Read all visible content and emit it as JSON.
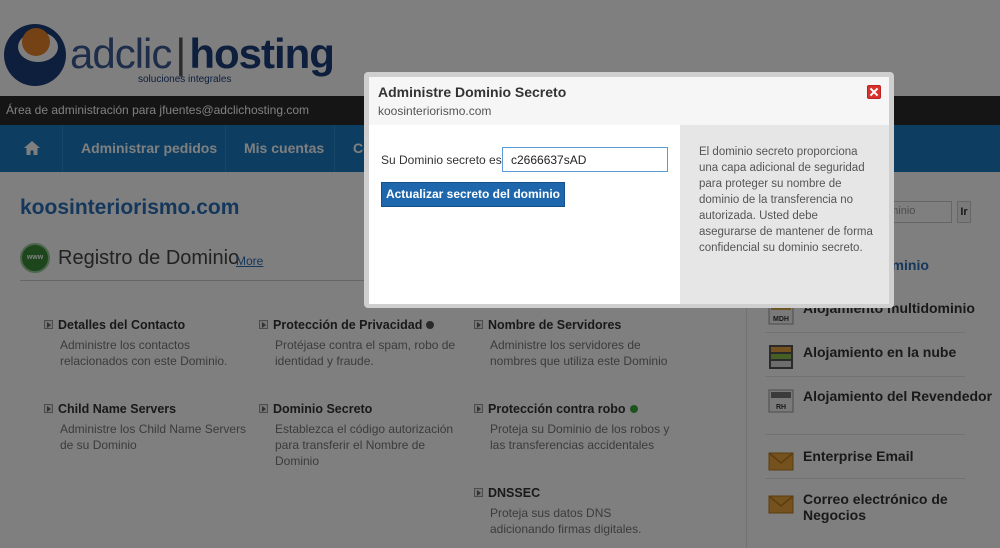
{
  "brand": {
    "name_light": "adclic",
    "name_separator": "|",
    "name_bold": "hosting",
    "tagline": "soluciones integrales",
    "colors": {
      "navy": "#1d3d7a",
      "orange": "#e8842a",
      "nav_blue": "#1a7dc2",
      "link_blue": "#2a6fb8"
    }
  },
  "admin_bar": {
    "text": "Área de administración para jfuentes@adclichosting.com"
  },
  "nav": {
    "home_icon": "home-icon",
    "items": [
      {
        "label": "Administrar pedidos"
      },
      {
        "label": "Mis cuentas"
      },
      {
        "label": "Co"
      }
    ]
  },
  "main": {
    "domain": "koosinteriorismo.com",
    "section": {
      "icon": "www-globe-icon",
      "icon_text": "www",
      "title": "Registro de Dominio",
      "more_link": "More"
    },
    "features": [
      {
        "title": "Detalles del Contacto",
        "desc": "Administre los contactos relacionados con este Dominio."
      },
      {
        "title": "Protección de Privacidad",
        "status_dot": "#555555",
        "desc": "Protéjase contra el spam, robo de identidad y fraude."
      },
      {
        "title": "Nombre de Servidores",
        "desc": "Administre los servidores de nombres que utiliza este Dominio"
      },
      {
        "title": "Child Name Servers",
        "desc": "Administre los Child Name Servers de su Dominio"
      },
      {
        "title": "Dominio Secreto",
        "desc": "Establezca el código autorización para transferir el Nombre de Dominio"
      },
      {
        "title": "Protección contra robo",
        "status_dot": "#3aa83a",
        "desc": "Proteja su Dominio de los robos y las transferencias accidentales"
      },
      {
        "title": "DNSSEC",
        "desc": "Proteja sus datos DNS adicionando firmas digitales."
      }
    ]
  },
  "sidebar": {
    "search_placeholder": "ominio",
    "search_button": "Ir",
    "items": [
      {
        "label": "ominio",
        "icon": "domain-icon"
      },
      {
        "label": "Alojamiento multidominio",
        "icon": "multidomain-hosting-icon",
        "icon_text": "MDH"
      },
      {
        "label": "Alojamiento en la nube",
        "icon": "cloud-hosting-icon"
      },
      {
        "label": "Alojamiento del Revendedor",
        "icon": "reseller-hosting-icon",
        "icon_text": "RH"
      },
      {
        "label": "Enterprise Email",
        "icon": "enterprise-email-icon"
      },
      {
        "label": "Correo electrónico de Negocios",
        "icon": "business-email-icon"
      }
    ]
  },
  "modal": {
    "title": "Administre Dominio Secreto",
    "subtitle": "koosinteriorismo.com",
    "close_icon": "close-icon",
    "field_label": "Su Dominio secreto es :",
    "field_value": "c2666637sAD",
    "submit_label": "Actualizar secreto del dominio",
    "info": "El dominio secreto proporciona una capa adicional de seguridad para proteger su nombre de dominio de la transferencia no autorizada. Usted debe asegurarse de mantener de forma confidencial su dominio secreto."
  }
}
